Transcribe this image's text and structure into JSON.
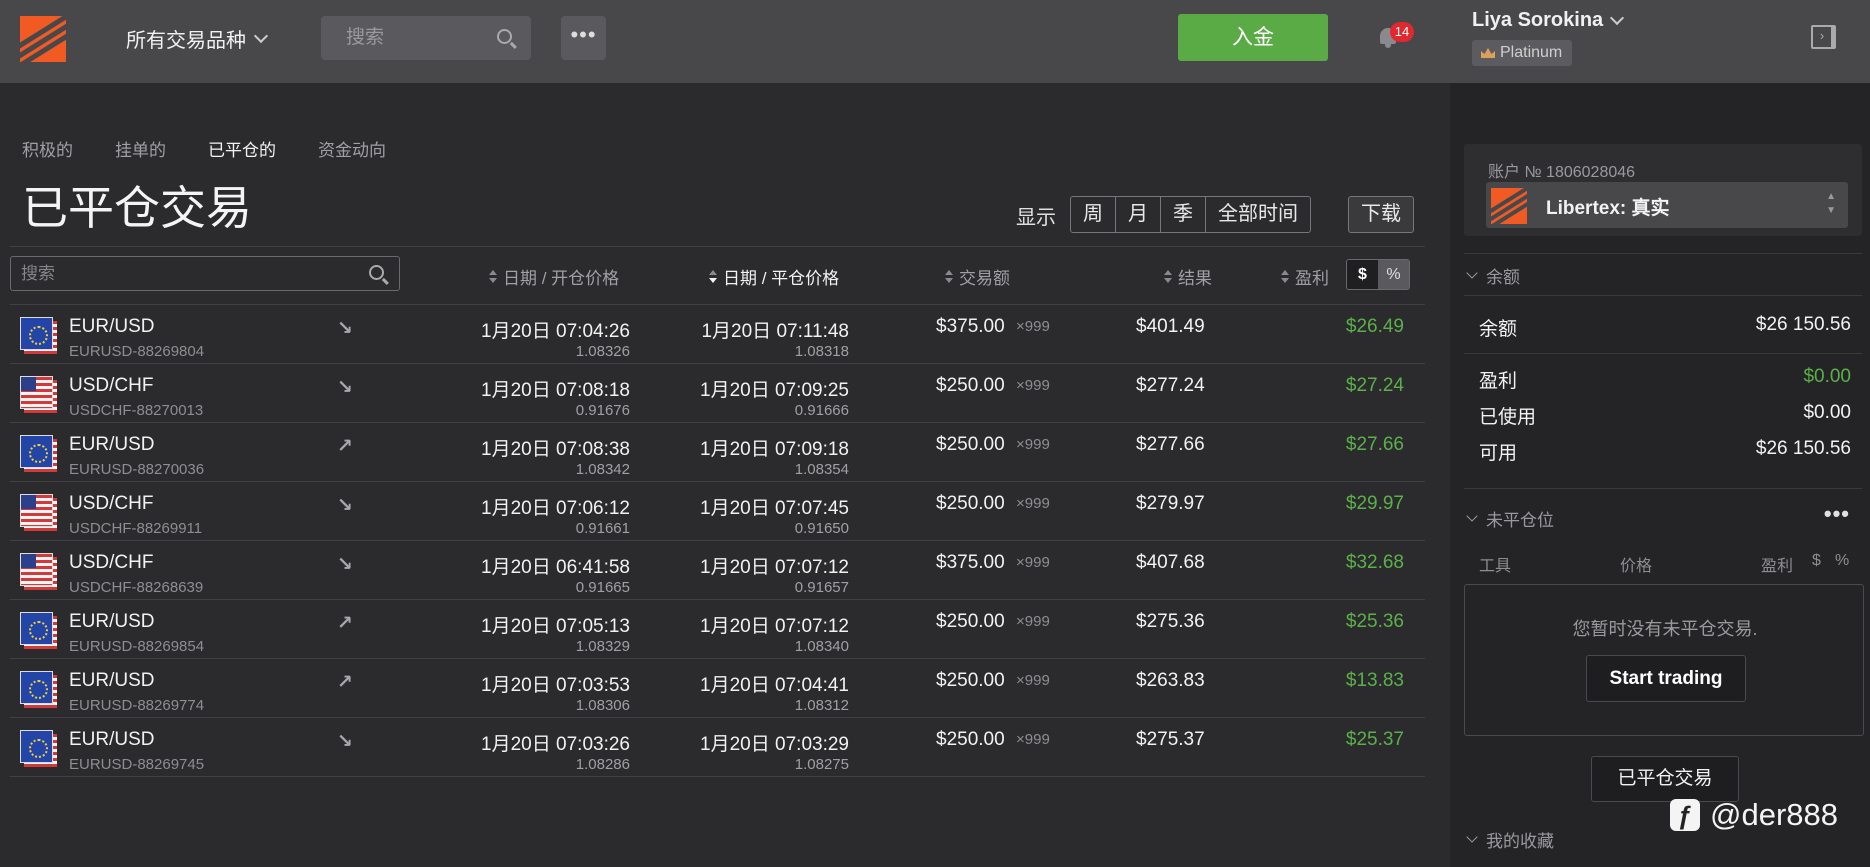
{
  "header": {
    "instrument_selector": "所有交易品种",
    "search_placeholder": "搜索",
    "more_label": "•••",
    "deposit_label": "入金",
    "notifications_count": "14",
    "user_name": "Liya Sorokina",
    "user_tier": "Platinum"
  },
  "tabs": [
    {
      "label": "积极的",
      "active": false
    },
    {
      "label": "挂单的",
      "active": false
    },
    {
      "label": "已平仓的",
      "active": true
    },
    {
      "label": "资金动向",
      "active": false
    }
  ],
  "page_title": "已平仓交易",
  "filters": {
    "show_label": "显示",
    "periods": [
      "周",
      "月",
      "季",
      "全部时间"
    ],
    "download_label": "下载"
  },
  "table": {
    "search_placeholder": "搜索",
    "columns": {
      "open": "日期 / 开仓价格",
      "close": "日期 / 平仓价格",
      "amount": "交易额",
      "result": "结果",
      "profit": "盈利"
    },
    "currency_toggle": [
      "$",
      "%"
    ],
    "rows": [
      {
        "symbol": "EUR/USD",
        "id": "EURUSD-88269804",
        "flag": "eu",
        "direction": "↘",
        "open_date": "1月20日 07:04:26",
        "open_price": "1.08326",
        "close_date": "1月20日 07:11:48",
        "close_price": "1.08318",
        "amount": "$375.00",
        "leverage": "×999",
        "result": "$401.49",
        "profit": "$26.49"
      },
      {
        "symbol": "USD/CHF",
        "id": "USDCHF-88270013",
        "flag": "us",
        "direction": "↘",
        "open_date": "1月20日 07:08:18",
        "open_price": "0.91676",
        "close_date": "1月20日 07:09:25",
        "close_price": "0.91666",
        "amount": "$250.00",
        "leverage": "×999",
        "result": "$277.24",
        "profit": "$27.24"
      },
      {
        "symbol": "EUR/USD",
        "id": "EURUSD-88270036",
        "flag": "eu",
        "direction": "↗",
        "open_date": "1月20日 07:08:38",
        "open_price": "1.08342",
        "close_date": "1月20日 07:09:18",
        "close_price": "1.08354",
        "amount": "$250.00",
        "leverage": "×999",
        "result": "$277.66",
        "profit": "$27.66"
      },
      {
        "symbol": "USD/CHF",
        "id": "USDCHF-88269911",
        "flag": "us",
        "direction": "↘",
        "open_date": "1月20日 07:06:12",
        "open_price": "0.91661",
        "close_date": "1月20日 07:07:45",
        "close_price": "0.91650",
        "amount": "$250.00",
        "leverage": "×999",
        "result": "$279.97",
        "profit": "$29.97"
      },
      {
        "symbol": "USD/CHF",
        "id": "USDCHF-88268639",
        "flag": "us",
        "direction": "↘",
        "open_date": "1月20日 06:41:58",
        "open_price": "0.91665",
        "close_date": "1月20日 07:07:12",
        "close_price": "0.91657",
        "amount": "$375.00",
        "leverage": "×999",
        "result": "$407.68",
        "profit": "$32.68"
      },
      {
        "symbol": "EUR/USD",
        "id": "EURUSD-88269854",
        "flag": "eu",
        "direction": "↗",
        "open_date": "1月20日 07:05:13",
        "open_price": "1.08329",
        "close_date": "1月20日 07:07:12",
        "close_price": "1.08340",
        "amount": "$250.00",
        "leverage": "×999",
        "result": "$275.36",
        "profit": "$25.36"
      },
      {
        "symbol": "EUR/USD",
        "id": "EURUSD-88269774",
        "flag": "eu",
        "direction": "↗",
        "open_date": "1月20日 07:03:53",
        "open_price": "1.08306",
        "close_date": "1月20日 07:04:41",
        "close_price": "1.08312",
        "amount": "$250.00",
        "leverage": "×999",
        "result": "$263.83",
        "profit": "$13.83"
      },
      {
        "symbol": "EUR/USD",
        "id": "EURUSD-88269745",
        "flag": "eu",
        "direction": "↘",
        "open_date": "1月20日 07:03:26",
        "open_price": "1.08286",
        "close_date": "1月20日 07:03:29",
        "close_price": "1.08275",
        "amount": "$250.00",
        "leverage": "×999",
        "result": "$275.37",
        "profit": "$25.37"
      }
    ]
  },
  "sidebar": {
    "account_label": "账户 № 1806028046",
    "account_name": "Libertex: 真实",
    "balance_section": "余额",
    "balance_rows": [
      {
        "label": "余额",
        "value": "$26 150.56",
        "green": false
      },
      {
        "label": "盈利",
        "value": "$0.00",
        "green": true
      },
      {
        "label": "已使用",
        "value": "$0.00",
        "green": false
      },
      {
        "label": "可用",
        "value": "$26 150.56",
        "green": false
      }
    ],
    "open_section": "未平仓位",
    "open_more": "•••",
    "open_columns": {
      "instrument": "工具",
      "price": "价格",
      "profit": "盈利",
      "usd": "$",
      "pct": "%"
    },
    "empty_text": "您暂时没有未平仓交易.",
    "start_trading": "Start trading",
    "closed_trades_button": "已平仓交易",
    "favorites_section": "我的收藏",
    "watermark": "@der888"
  },
  "colors": {
    "accent": "#f25a24",
    "deposit": "#5aaa46",
    "profit": "#5bb04a",
    "badge": "#e0282e"
  }
}
